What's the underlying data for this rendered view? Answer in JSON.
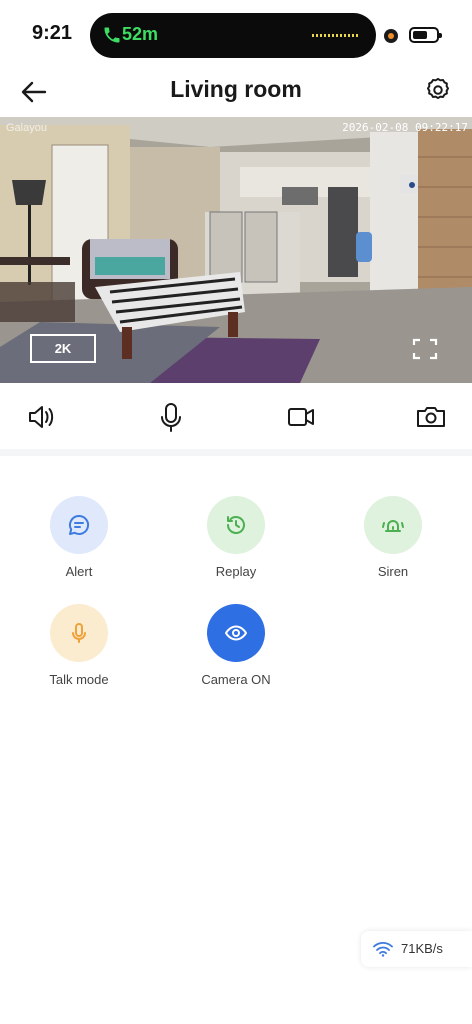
{
  "status_bar": {
    "time": "9:21",
    "call_duration": "52m"
  },
  "header": {
    "title": "Living room",
    "back_icon": "arrow-left-icon",
    "settings_icon": "gear-icon"
  },
  "video": {
    "logo": "Galayou",
    "timestamp": "2026-02-08 09:22:17",
    "resolution": "2K",
    "fullscreen_icon": "fullscreen-icon"
  },
  "controls": [
    {
      "icon": "speaker-icon"
    },
    {
      "icon": "microphone-icon"
    },
    {
      "icon": "video-record-icon"
    },
    {
      "icon": "camera-snapshot-icon"
    }
  ],
  "features": [
    {
      "label": "Alert",
      "icon": "message-icon",
      "bg": "#dfe9fb",
      "fg": "#3d7be0"
    },
    {
      "label": "Replay",
      "icon": "history-icon",
      "bg": "#def2dd",
      "fg": "#4caf50"
    },
    {
      "label": "Siren",
      "icon": "siren-icon",
      "bg": "#def2dd",
      "fg": "#4caf50"
    },
    {
      "label": "Talk mode",
      "icon": "microphone-icon",
      "bg": "#fbecd0",
      "fg": "#f0a23a"
    },
    {
      "label": "Camera ON",
      "icon": "eye-icon",
      "bg": "#2f6fe4",
      "fg": "#ffffff"
    }
  ],
  "network": {
    "rate": "71KB/s",
    "icon": "wifi-icon"
  },
  "colors": {
    "accent_blue": "#2f6fe4",
    "call_green": "#3ddc63"
  }
}
